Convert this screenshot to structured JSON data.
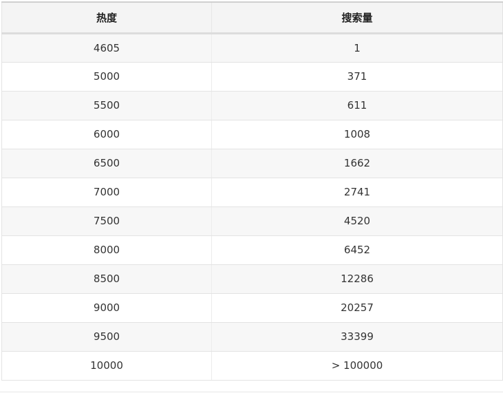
{
  "table": {
    "headers": [
      "热度",
      "搜索量"
    ],
    "rows": [
      [
        "4605",
        "1"
      ],
      [
        "5000",
        "371"
      ],
      [
        "5500",
        "611"
      ],
      [
        "6000",
        "1008"
      ],
      [
        "6500",
        "1662"
      ],
      [
        "7000",
        "2741"
      ],
      [
        "7500",
        "4520"
      ],
      [
        "8000",
        "6452"
      ],
      [
        "8500",
        "12286"
      ],
      [
        "9000",
        "20257"
      ],
      [
        "9500",
        "33399"
      ],
      [
        "10000",
        "> 100000"
      ]
    ]
  }
}
